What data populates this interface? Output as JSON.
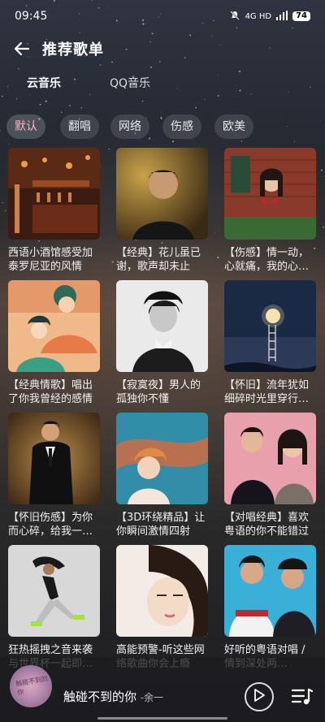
{
  "status_bar": {
    "time": "09:45",
    "network": "4G HD",
    "battery": "74"
  },
  "header": {
    "title": "推荐歌单"
  },
  "source_tabs": [
    {
      "label": "云音乐",
      "active": true
    },
    {
      "label": "QQ音乐",
      "active": false
    }
  ],
  "categories": [
    {
      "label": "默认",
      "selected": true
    },
    {
      "label": "翻唱",
      "selected": false
    },
    {
      "label": "网络",
      "selected": false
    },
    {
      "label": "伤感",
      "selected": false
    },
    {
      "label": "欧美",
      "selected": false
    }
  ],
  "playlists": [
    {
      "title": "西语小酒馆感受加泰罗尼亚的风情",
      "art": "bar-interior"
    },
    {
      "title": "【经典】花儿虽已谢，歌声却未止",
      "art": "man-portrait"
    },
    {
      "title": "【伤感】情一动，心就痛，我的心…",
      "art": "woman-brick-wall"
    },
    {
      "title": "【经典情歌】唱出了你我曾经的感情",
      "art": "couple-illustration"
    },
    {
      "title": "【寂寞夜】男人的孤独你不懂",
      "art": "bw-man-portrait"
    },
    {
      "title": "【怀旧】流年犹如细碎时光里穿行…",
      "art": "moon-ladder"
    },
    {
      "title": "【怀旧伤感】为你而心碎，给我一…",
      "art": "man-suit"
    },
    {
      "title": "【3D环绕精品】让你瞬间激情四射",
      "art": "teal-hair-girl"
    },
    {
      "title": "【对唱经典】喜欢粤语的你不能错过",
      "art": "couple-pink"
    },
    {
      "title": "狂热摇拽之音来袭与世界杯一起即…",
      "art": "dancer"
    },
    {
      "title": "高能预警-听这些网络歌曲你会上瘾",
      "art": "woman-closeup"
    },
    {
      "title": "好听的粤语对唱 / 情到深处两…",
      "art": "two-men"
    }
  ],
  "now_playing": {
    "song": "触碰不到的你",
    "artist": "-余一",
    "disc_caption": "触碰不到的你"
  },
  "icons": {
    "back": "arrow-left-icon",
    "play": "play-icon",
    "playlist": "playlist-icon",
    "mute": "bell-off-icon"
  }
}
